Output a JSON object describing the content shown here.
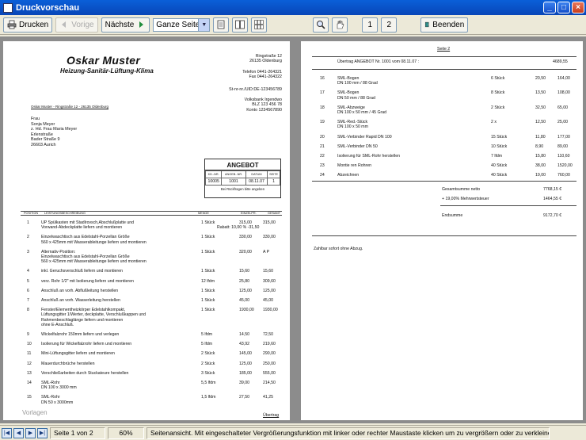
{
  "window": {
    "title": "Druckvorschau"
  },
  "toolbar": {
    "print_label": "Drucken",
    "prev_label": "Vorige",
    "next_label": "Nächste",
    "zoom_value": "Ganze Seite",
    "page1_label": "1",
    "page2_label": "2",
    "exit_label": "Beenden"
  },
  "doc": {
    "company_name": "Oskar Muster",
    "company_trade": "Heizung-Sanitär-Lüftung-Klima",
    "addr_street": "Ringstraße 12",
    "addr_city": "26135 Oldenburg",
    "phone": "Telefon 0441-264321",
    "fax": "Fax 0441-264322",
    "tax": "St-nr-nr./UID:DE-123456789",
    "bank_name": "Volksbank Irgendwo",
    "bank_blz": "BLZ 123 456 78",
    "bank_konto": "Konto 1234567890",
    "sender_line": "Oskar Muster - Ringstraße 12 - 26135 Oldenburg",
    "recipient": [
      "Frau",
      "Sonja Meyer",
      "z. Hd. Frau Maria Meyer",
      "Erlenstraße",
      "Bader Straße 9",
      "26603 Aurich"
    ],
    "angebot": {
      "title": "ANGEBOT",
      "col_kdnr": "KD.-NR.",
      "col_angnr": "ANGEB.-NR.",
      "col_datum": "DATUM",
      "col_seite": "SEITE",
      "kdnr": "10005",
      "angnr": "1001",
      "datum": "08.11.07",
      "seite": "1",
      "note": "Bei Rückfragen bitte angeben"
    },
    "table_head": {
      "pos": "POSITION",
      "desc": "LEISTUNGSBESCHREIBUNG",
      "qty": "MENGE",
      "ep": "EINZELPR.",
      "gp": "GESAMT"
    },
    "items": [
      {
        "nr": "1",
        "desc": [
          "UP Spülkasten mit Stadlrovsch,Abschlußplatte und",
          "Vorwand-Abdeckplatte liefern und montieren"
        ],
        "qty": "1 Stück",
        "ep": "315,00",
        "gp": "315,00",
        "extra": "Rabatt:   10,00 %   -31,50"
      },
      {
        "nr": "2",
        "desc": [
          "Einzelwaschtisch aus Edelstahl-Porzellan Größe",
          "560 x 425mm mit Wasserableitunge liefern und montieren"
        ],
        "qty": "1 Stück",
        "ep": "330,00",
        "gp": "330,00"
      },
      {
        "nr": "3",
        "desc": [
          "Alternativ-Position:",
          "Einzelwaschtisch aus Edelstahl-Porzellan Größe",
          "560 x 425mm mit Wasserableitunge liefern und montieren"
        ],
        "qty": "1 Stück",
        "ep": "320,00",
        "gp": "A P"
      },
      {
        "nr": "4",
        "desc": [
          "inkl. Geruchsverschluß liefern und montieren"
        ],
        "qty": "1 Stück",
        "ep": "15,60",
        "gp": "15,60"
      },
      {
        "nr": "5",
        "desc": [
          "verz. Rohr 1/2\" mit Isolierung liefern und montieren"
        ],
        "qty": "12 lfdm",
        "ep": "25,80",
        "gp": "309,60"
      },
      {
        "nr": "6",
        "desc": [
          "Anschluß an vorh. Abflußleitung herstellen"
        ],
        "qty": "1 Stück",
        "ep": "125,00",
        "gp": "125,00"
      },
      {
        "nr": "7",
        "desc": [
          "Anschluß an vorh. Wasserleitung herstellen"
        ],
        "qty": "1 Stück",
        "ep": "45,00",
        "gp": "45,00"
      },
      {
        "nr": "8",
        "desc": [
          "Fenster/Elementheizkörper Edelstahlkompakt,",
          "Lüftungsgitter 1/Werter, deckplatte, Verschlußkappen und",
          "Rahmenbeschlaglänge liefern und montieren",
          "ohne E-Anschluß."
        ],
        "qty": "1 Stück",
        "ep": "1930,00",
        "gp": "1930,00"
      },
      {
        "nr": "9",
        "desc": [
          "Wickelfalzrohr 150mm liefern und verlegen"
        ],
        "qty": "5 lfdm",
        "ep": "14,50",
        "gp": "72,50"
      },
      {
        "nr": "10",
        "desc": [
          "Isolierung für Wickelfalzrohr liefern und montieren"
        ],
        "qty": "5 lfdm",
        "ep": "43,92",
        "gp": "219,60"
      },
      {
        "nr": "11",
        "desc": [
          "Mini-Lüftungsgitter liefern und montieren"
        ],
        "qty": "2 Stück",
        "ep": "145,00",
        "gp": "290,00"
      },
      {
        "nr": "12",
        "desc": [
          "Mauerdurchbrüche herstellen"
        ],
        "qty": "2 Stück",
        "ep": "125,00",
        "gp": "250,00"
      },
      {
        "nr": "13",
        "desc": [
          "Verschließarbeiten durch Stuckateure herstellen"
        ],
        "qty": "3 Stück",
        "ep": "185,00",
        "gp": "555,00"
      },
      {
        "nr": "14",
        "desc": [
          "SML-Rohr",
          "DN 100 x 3000 mm"
        ],
        "qty": "5,5 lfdm",
        "ep": "39,00",
        "gp": "214,50"
      },
      {
        "nr": "15",
        "desc": [
          "SML-Rohr",
          "DN 50 x 3000mm"
        ],
        "qty": "1,5 lfdm",
        "ep": "27,50",
        "gp": "41,25"
      }
    ],
    "carry_label": "Übertrag",
    "p2_header": "Seite 2",
    "p2_carry": "Übertrag ANGEBOT Nr. 1001 vom 08.11.07 :",
    "p2_carry_val": "4689,55",
    "p2_items": [
      {
        "nr": "16",
        "desc": [
          "SML-Bogen",
          "DN 100 mm / 88 Grad"
        ],
        "qty": "6 Stück",
        "ep": "20,50",
        "gp": "164,00"
      },
      {
        "nr": "17",
        "desc": [
          "SML-Bogen",
          "DN 50 mm / 88 Grad"
        ],
        "qty": "8 Stück",
        "ep": "13,50",
        "gp": "108,00"
      },
      {
        "nr": "18",
        "desc": [
          "SML-Abzweige",
          "DN 100 x 50 mm / 45 Grad"
        ],
        "qty": "2 Stück",
        "ep": "32,50",
        "gp": "65,00"
      },
      {
        "nr": "19",
        "desc": [
          "SML-Red.-Stück",
          "DN 100 x 50 mm"
        ],
        "qty": "2 x",
        "ep": "12,50",
        "gp": "25,00"
      },
      {
        "nr": "20",
        "desc": [
          "SML-Verbinder Rapid DN 100"
        ],
        "qty": "15 Stück",
        "ep": "11,80",
        "gp": "177,00"
      },
      {
        "nr": "21",
        "desc": [
          "SML-Verbinder DN 50"
        ],
        "qty": "10 Stück",
        "ep": "8,90",
        "gp": "89,00"
      },
      {
        "nr": "22",
        "desc": [
          "Isolierung für SML-Rohr herstellen"
        ],
        "qty": "7 lfdm",
        "ep": "15,80",
        "gp": "110,60"
      },
      {
        "nr": "23",
        "desc": [
          "Montie ren Rohren"
        ],
        "qty": "40 Stück",
        "ep": "38,00",
        "gp": "1520,00"
      },
      {
        "nr": "24",
        "desc": [
          "Abzeichnen"
        ],
        "qty": "40 Stück",
        "ep": "19,00",
        "gp": "760,00"
      }
    ],
    "sum_net_label": "Gesamtsumme netto",
    "sum_net": "7768,15 €",
    "vat_label": "+ 19,00% Mehrwertsteuer",
    "vat": "1464,55 €",
    "total_label": "Endsumme",
    "total": "9172,70 €",
    "payment_terms": "Zahlbar sofort ohne Abzug."
  },
  "footer_watermark": "Vorlagen",
  "status": {
    "page": "Seite 1 von 2",
    "zoom": "60%",
    "hint": "Seitenansicht.  Mit eingeschalteter Vergrößerungsfunktion mit linker oder rechter Maustaste klicken um zu vergrößern oder zu verkleinern.  Bei"
  }
}
